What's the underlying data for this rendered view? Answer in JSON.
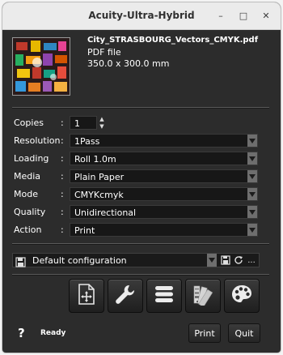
{
  "window": {
    "title": "Acuity-Ultra-Hybrid"
  },
  "window_controls": {
    "minimize": "–",
    "maximize": "□",
    "close": "✕"
  },
  "file": {
    "name": "City_STRASBOURG_Vectors_CMYK.pdf",
    "type": "PDF file",
    "size": "350.0 x 300.0 mm"
  },
  "colon": ":",
  "copies": {
    "label": "Copies",
    "value": "1",
    "up": "▲",
    "down": "▼"
  },
  "settings": [
    {
      "key": "resolution",
      "label": "Resolution",
      "value": "1Pass"
    },
    {
      "key": "loading",
      "label": "Loading",
      "value": "Roll 1.0m"
    },
    {
      "key": "media",
      "label": "Media",
      "value": "Plain Paper"
    },
    {
      "key": "mode",
      "label": "Mode",
      "value": "CMYKcmyk"
    },
    {
      "key": "quality",
      "label": "Quality",
      "value": "Unidirectional"
    },
    {
      "key": "action",
      "label": "Action",
      "value": "Print"
    }
  ],
  "config": {
    "value": "Default configuration",
    "more": "..."
  },
  "toolbar_icons": [
    "add-page-icon",
    "wrench-icon",
    "list-icon",
    "color-swatch-icon",
    "palette-icon"
  ],
  "footer": {
    "help": "?",
    "status": "Ready",
    "print_label": "Print",
    "quit_label": "Quit"
  },
  "colors": {
    "background": "#2c2c2c",
    "field": "#171717",
    "titlebar": "#ebebeb"
  }
}
